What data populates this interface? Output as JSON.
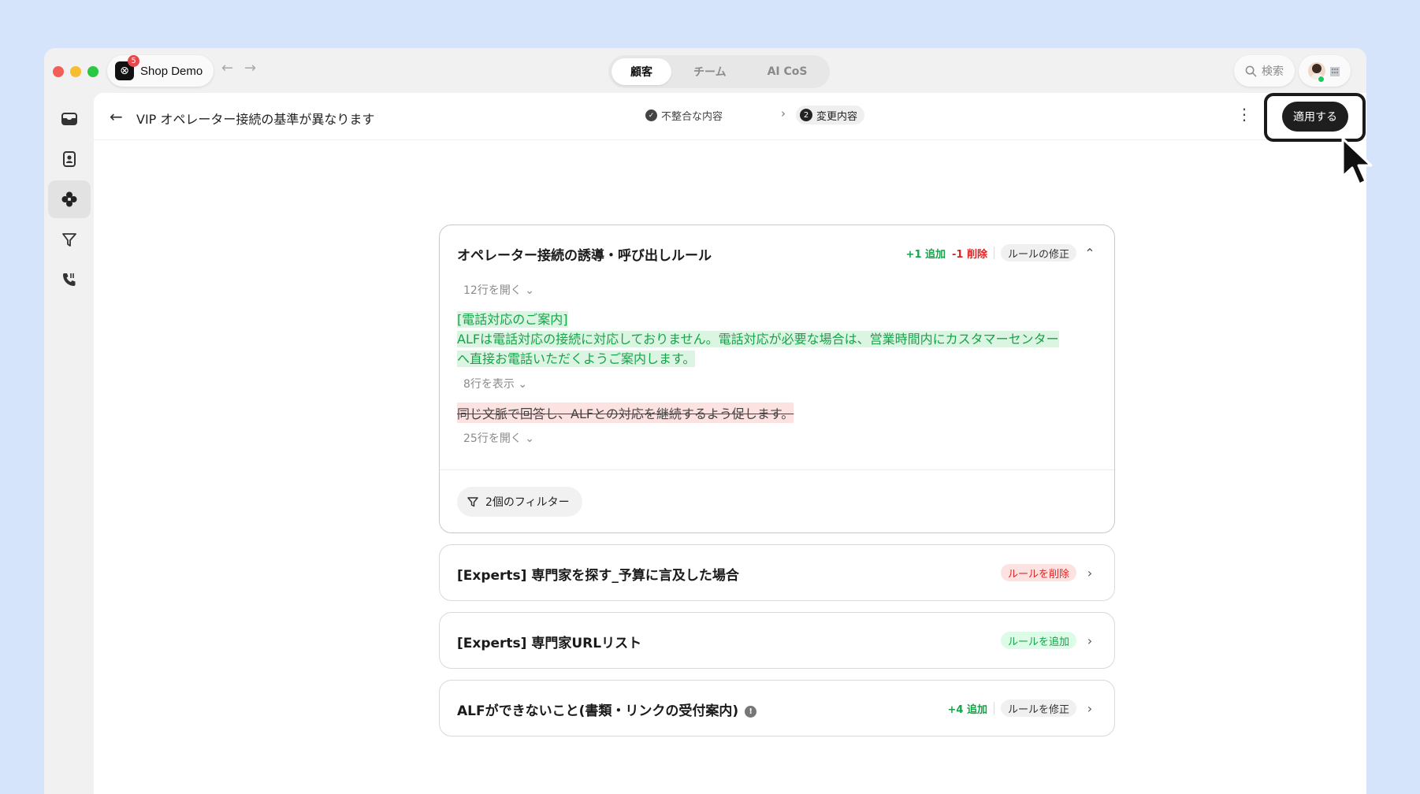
{
  "titlebar": {
    "workspace_name": "Shop Demo",
    "workspace_logo": "⊗",
    "notification_count": "5",
    "tabs": [
      {
        "label": "顧客",
        "active": true
      },
      {
        "label": "チーム",
        "active": false
      },
      {
        "label": "AI CoS",
        "active": false
      }
    ],
    "search_label": "検索"
  },
  "sidebar": {
    "items": [
      {
        "icon": "inbox-icon"
      },
      {
        "icon": "contacts-icon"
      },
      {
        "icon": "alf-icon",
        "active": true
      },
      {
        "icon": "marketing-icon"
      },
      {
        "icon": "phone-icon"
      }
    ]
  },
  "header": {
    "back_glyph": "←",
    "title": "VIP オペレーター接続の基準が異なります",
    "breadcrumb_step1": "不整合な内容",
    "breadcrumb_step2_number": "2",
    "breadcrumb_step2": "変更内容",
    "apply_label": "適用する"
  },
  "cards": [
    {
      "title": "オペレーター接続の誘導・呼び出しルール",
      "added": "+1 追加",
      "removed": "-1 削除",
      "tag": "ルールの修正",
      "expand_top": "12行を開く",
      "added_lines": [
        "[電話対応のご案内]",
        "ALFは電話対応の接続に対応しておりません。電話対応が必要な場合は、営業時間内にカスタマーセンター",
        "へ直接お電話いただくようご案内します。"
      ],
      "expand_mid": "8行を表示",
      "removed_line": "同じ文脈で回答し、ALFとの対応を継続するよう促します。",
      "expand_bottom": "25行を開く",
      "filter_label": "2個のフィルター"
    },
    {
      "title": "[Experts] 専門家を探す_予算に言及した場合",
      "tag": "ルールを削除"
    },
    {
      "title": "[Experts] 専門家URLリスト",
      "tag": "ルールを追加"
    },
    {
      "title": "ALFができないこと(書類・リンクの受付案内)",
      "added": "+4 追加",
      "tag": "ルールを修正"
    }
  ]
}
